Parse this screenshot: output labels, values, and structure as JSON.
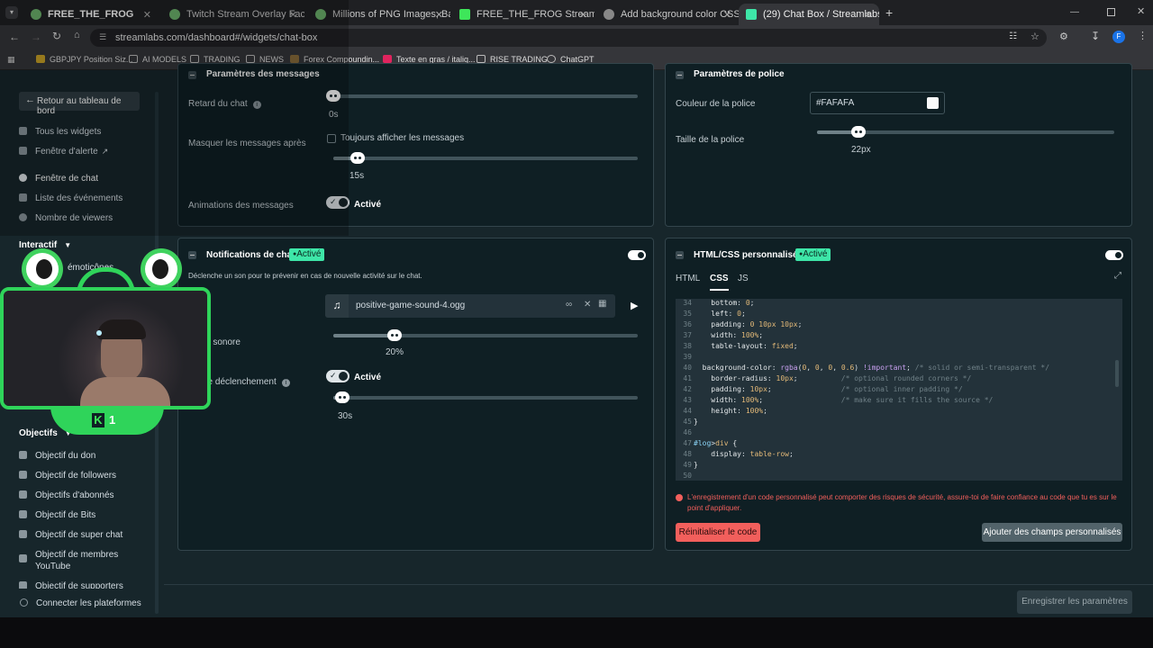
{
  "browser": {
    "tabs": [
      {
        "label": "FREE_THE_FROG"
      },
      {
        "label": "Twitch Stream Overlay Facecam"
      },
      {
        "label": "Millions of PNG Images, Backgr"
      },
      {
        "label": "FREE_THE_FROG Stream - Watc"
      },
      {
        "label": "Add background color CSS"
      },
      {
        "label": "(29) Chat Box / Streamlabs"
      }
    ],
    "url": "streamlabs.com/dashboard#/widgets/chat-box",
    "bookmarks": [
      "GBPJPY Position Siz...",
      "AI MODELS",
      "TRADING",
      "NEWS",
      "Forex Compoundin...",
      "Texte en gras / italiq...",
      "RISE TRADING",
      "ChatGPT"
    ],
    "profile_letter": "F"
  },
  "sidebar": {
    "back_label": "Retour au tableau de bord",
    "items": [
      "Tous les widgets",
      "Fenêtre d'alerte",
      "Fenêtre de chat",
      "Liste des événements",
      "Nombre de viewers"
    ],
    "interactif_label": "Interactif",
    "emoticones_label": "émoticônes",
    "objectifs_label": "Objectifs",
    "goals": [
      "Objectif du don",
      "Objectif de followers",
      "Objectifs d'abonnés",
      "Objectif de Bits",
      "Objectif de super chat",
      "Objectif de membres YouTube",
      "Objectif de supporters"
    ],
    "connect_label": "Connecter les plateformes"
  },
  "messages": {
    "title": "Paramètres des messages",
    "delay_label": "Retard du chat",
    "delay_value": "0s",
    "hide_label": "Masquer les messages après",
    "always_show": "Toujours afficher les messages",
    "hide_value": "15s",
    "hide_fraction": 0.08,
    "anim_label": "Animations des messages",
    "anim_state": "Activé"
  },
  "font": {
    "title": "Paramètres de police",
    "color_label": "Couleur de la police",
    "color_value": "#FAFAFA",
    "size_label": "Taille de la police",
    "size_value": "22px",
    "size_fraction": 0.14
  },
  "notifications": {
    "title": "Notifications de chat",
    "badge": "Activé",
    "description": "Déclenche un son pour te prévenir en cas de nouvelle activité sur le chat.",
    "sound_file": "positive-game-sound-4.ogg",
    "volume_label": "e sonore",
    "volume_value": "20%",
    "volume_fraction": 0.2,
    "trigger_label": "de déclenchement",
    "trigger_state": "Activé",
    "trigger_value": "30s",
    "trigger_fraction": 0.03
  },
  "customcode": {
    "title": "HTML/CSS personnalisés",
    "badge": "Activé",
    "tabs": [
      "HTML",
      "CSS",
      "JS"
    ],
    "warning": "L'enregistrement d'un code personnalisé peut comporter des risques de sécurité, assure-toi de faire confiance au code que tu es sur le point d'appliquer.",
    "reset_label": "Réinitialiser le code",
    "add_fields_label": "Ajouter des champs personnalisés"
  },
  "save_label": "Enregistrer les paramètres",
  "facecam": {
    "badge": "1"
  },
  "colors": {
    "accent": "#3ee6a8",
    "danger": "#f25f5c",
    "frog": "#2fd45a"
  }
}
